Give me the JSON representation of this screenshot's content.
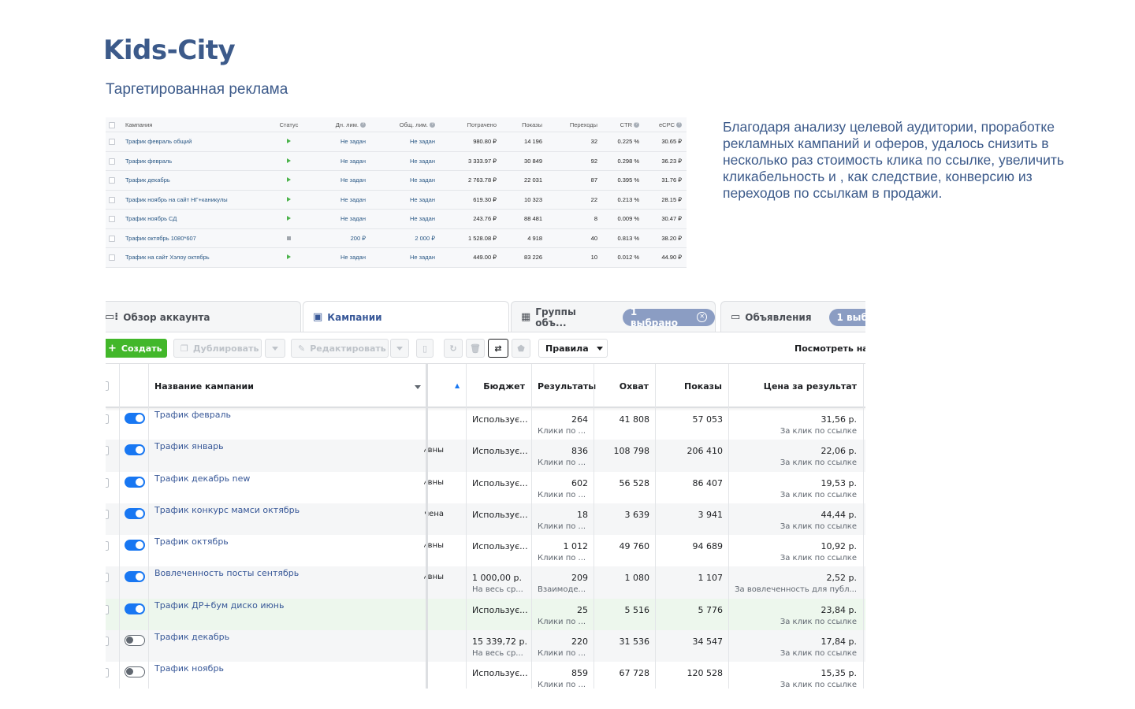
{
  "header": {
    "brand": "Kids-City",
    "subtitle": "Таргетированная реклама",
    "description": "Благодаря анализу целевой аудитории, проработке рекламных кампаний и оферов, удалось снизить в несколько раз стоимость клика по ссылке, увеличить кликабельность и , как следствие, конверсию из переходов по ссылкам в продажи."
  },
  "vk_table": {
    "headers": {
      "campaign": "Кампания",
      "status": "Статус",
      "day_limit": "Дн. лим.",
      "total_limit": "Общ. лим.",
      "spent": "Потрачено",
      "shows": "Показы",
      "clicks": "Переходы",
      "ctr": "CTR",
      "ecpc": "eCPC"
    },
    "rows": [
      {
        "name": "Трафик февраль общий",
        "status": "active",
        "day": "Не задан",
        "total": "Не задан",
        "spent": "980.80 ₽",
        "shows": "14 196",
        "clicks": "32",
        "ctr": "0.225 %",
        "ecpc": "30.65 ₽"
      },
      {
        "name": "Трафик февраль",
        "status": "active",
        "day": "Не задан",
        "total": "Не задан",
        "spent": "3 333.97 ₽",
        "shows": "30 849",
        "clicks": "92",
        "ctr": "0.298 %",
        "ecpc": "36.23 ₽"
      },
      {
        "name": "Трафик декабрь",
        "status": "active",
        "day": "Не задан",
        "total": "Не задан",
        "spent": "2 763.78 ₽",
        "shows": "22 031",
        "clicks": "87",
        "ctr": "0.395 %",
        "ecpc": "31.76 ₽"
      },
      {
        "name": "Трафик ноябрь на сайт НГ+каникулы",
        "status": "active",
        "day": "Не задан",
        "total": "Не задан",
        "spent": "619.30 ₽",
        "shows": "10 323",
        "clicks": "22",
        "ctr": "0.213 %",
        "ecpc": "28.15 ₽"
      },
      {
        "name": "Трафик ноябрь СД",
        "status": "active",
        "day": "Не задан",
        "total": "Не задан",
        "spent": "243.76 ₽",
        "shows": "88 481",
        "clicks": "8",
        "ctr": "0.009 %",
        "ecpc": "30.47 ₽"
      },
      {
        "name": "Трафик октябрь 1080*607",
        "status": "stopped",
        "day": "200 ₽",
        "total": "2 000 ₽",
        "spent": "1 528.08 ₽",
        "shows": "4 918",
        "clicks": "40",
        "ctr": "0.813 %",
        "ecpc": "38.20 ₽"
      },
      {
        "name": "Трафик на сайт Хэлоу октябрь",
        "status": "active",
        "day": "Не задан",
        "total": "Не задан",
        "spent": "449.00 ₽",
        "shows": "83 226",
        "clicks": "10",
        "ctr": "0.012 %",
        "ecpc": "44.90 ₽"
      }
    ]
  },
  "fb": {
    "tabs": {
      "overview": "Обзор аккаунта",
      "campaigns": "Кампании",
      "adsets": "Группы объ...",
      "adsets_pill": "1 выбрано",
      "ads": "Объявления",
      "ads_pill": "1 выб"
    },
    "toolbar": {
      "create": "Создать",
      "duplicate": "Дублировать",
      "edit": "Редактировать",
      "rules": "Правила",
      "view_settings": "Посмотреть нас"
    },
    "columns": {
      "name": "Название кампании",
      "budget": "Бюджет",
      "results": "Результаты",
      "reach": "Охват",
      "impressions": "Показы",
      "cost": "Цена за результат"
    },
    "rows": [
      {
        "name": "Трафик февраль",
        "on": true,
        "delivery": "",
        "budget": "Использує...",
        "budget_sub": "",
        "results": "264",
        "results_sub": "Клики по ...",
        "reach": "41 808",
        "impressions": "57 053",
        "cost": "31,56 р.",
        "cost_sub": "За клик по ссылке"
      },
      {
        "name": "Трафик январь",
        "on": true,
        "delivery": "ивны",
        "budget": "Использує...",
        "budget_sub": "",
        "results": "836",
        "results_sub": "Клики по ...",
        "reach": "108 798",
        "impressions": "206 410",
        "cost": "22,06 р.",
        "cost_sub": "За клик по ссылке"
      },
      {
        "name": "Трафик декабрь new",
        "on": true,
        "delivery": "ивны",
        "budget": "Использує...",
        "budget_sub": "",
        "results": "602",
        "results_sub": "Клики по ...",
        "reach": "56 528",
        "impressions": "86 407",
        "cost": "19,53 р.",
        "cost_sub": "За клик по ссылке"
      },
      {
        "name": "Трафик конкурс мамси октябрь",
        "on": true,
        "delivery": "чена",
        "budget": "Использує...",
        "budget_sub": "",
        "results": "18",
        "results_sub": "Клики по ...",
        "reach": "3 639",
        "impressions": "3 941",
        "cost": "44,44 р.",
        "cost_sub": "За клик по ссылке"
      },
      {
        "name": "Трафик октябрь",
        "on": true,
        "delivery": "ивны",
        "budget": "Использує...",
        "budget_sub": "",
        "results": "1 012",
        "results_sub": "Клики по ...",
        "reach": "49 760",
        "impressions": "94 689",
        "cost": "10,92 р.",
        "cost_sub": "За клик по ссылке"
      },
      {
        "name": "Вовлеченность посты сентябрь",
        "on": true,
        "delivery": "ивны",
        "budget": "1 000,00 р.",
        "budget_sub": "На весь ср...",
        "results": "209",
        "results_sub": "Взаимоде...",
        "reach": "1 080",
        "impressions": "1 107",
        "cost": "2,52 р.",
        "cost_sub": "За вовлеченность для публ..."
      },
      {
        "name": "Трафик ДР+бум диско июнь",
        "on": true,
        "delivery": "",
        "budget": "Использує...",
        "budget_sub": "",
        "results": "25",
        "results_sub": "Клики по ...",
        "reach": "5 516",
        "impressions": "5 776",
        "cost": "23,84 р.",
        "cost_sub": "За клик по ссылке"
      },
      {
        "name": "Трафик декабрь",
        "on": false,
        "delivery": "",
        "budget": "15 339,72 р.",
        "budget_sub": "На весь ср...",
        "results": "220",
        "results_sub": "Клики по ...",
        "reach": "31 536",
        "impressions": "34 547",
        "cost": "17,84 р.",
        "cost_sub": "За клик по ссылке"
      },
      {
        "name": "Трафик ноябрь",
        "on": false,
        "delivery": "",
        "budget": "Использує...",
        "budget_sub": "",
        "results": "859",
        "results_sub": "Клики по ...",
        "reach": "67 728",
        "impressions": "120 528",
        "cost": "15,35 р.",
        "cost_sub": "За клик по ссылке"
      }
    ]
  }
}
